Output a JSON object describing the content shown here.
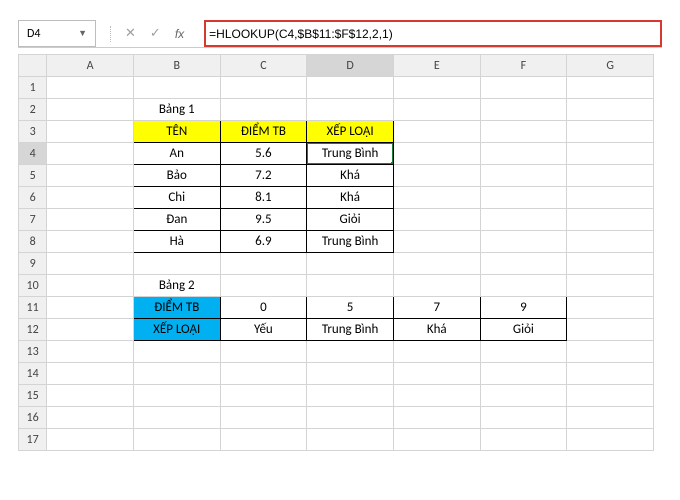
{
  "namebox": {
    "value": "D4",
    "dropdown_glyph": "▼"
  },
  "fbar": {
    "cancel_glyph": "✕",
    "accept_glyph": "✓",
    "fx_label": "fx",
    "formula": "=HLOOKUP(C4,$B$11:$F$12,2,1)"
  },
  "columns": [
    "A",
    "B",
    "C",
    "D",
    "E",
    "F",
    "G"
  ],
  "rows": [
    "1",
    "2",
    "3",
    "4",
    "5",
    "6",
    "7",
    "8",
    "9",
    "10",
    "11",
    "12",
    "13",
    "14",
    "15",
    "16",
    "17"
  ],
  "selected": {
    "col": "D",
    "row": "4"
  },
  "b1": {
    "title": "Bảng 1",
    "headers": [
      "TÊN",
      "ĐIỂM TB",
      "XẾP LOẠI"
    ],
    "rows": [
      {
        "ten": "An",
        "diem": "5.6",
        "xep": "Trung Bình"
      },
      {
        "ten": "Bảo",
        "diem": "7.2",
        "xep": "Khá"
      },
      {
        "ten": "Chi",
        "diem": "8.1",
        "xep": "Khá"
      },
      {
        "ten": "Đan",
        "diem": "9.5",
        "xep": "Giỏi"
      },
      {
        "ten": "Hà",
        "diem": "6.9",
        "xep": "Trung Bình"
      }
    ]
  },
  "b2": {
    "title": "Bảng 2",
    "row_headers": [
      "ĐIỂM TB",
      "XẾP LOẠI"
    ],
    "vals": [
      "0",
      "5",
      "7",
      "9"
    ],
    "labels": [
      "Yếu",
      "Trung Bình",
      "Khá",
      "Giỏi"
    ]
  },
  "chart_data": {
    "type": "table",
    "tables": [
      {
        "title": "Bảng 1",
        "columns": [
          "TÊN",
          "ĐIỂM TB",
          "XẾP LOẠI"
        ],
        "rows": [
          [
            "An",
            5.6,
            "Trung Bình"
          ],
          [
            "Bảo",
            7.2,
            "Khá"
          ],
          [
            "Chi",
            8.1,
            "Khá"
          ],
          [
            "Đan",
            9.5,
            "Giỏi"
          ],
          [
            "Hà",
            6.9,
            "Trung Bình"
          ]
        ]
      },
      {
        "title": "Bảng 2",
        "rows": [
          [
            "ĐIỂM TB",
            0,
            5,
            7,
            9
          ],
          [
            "XẾP LOẠI",
            "Yếu",
            "Trung Bình",
            "Khá",
            "Giỏi"
          ]
        ]
      }
    ]
  }
}
